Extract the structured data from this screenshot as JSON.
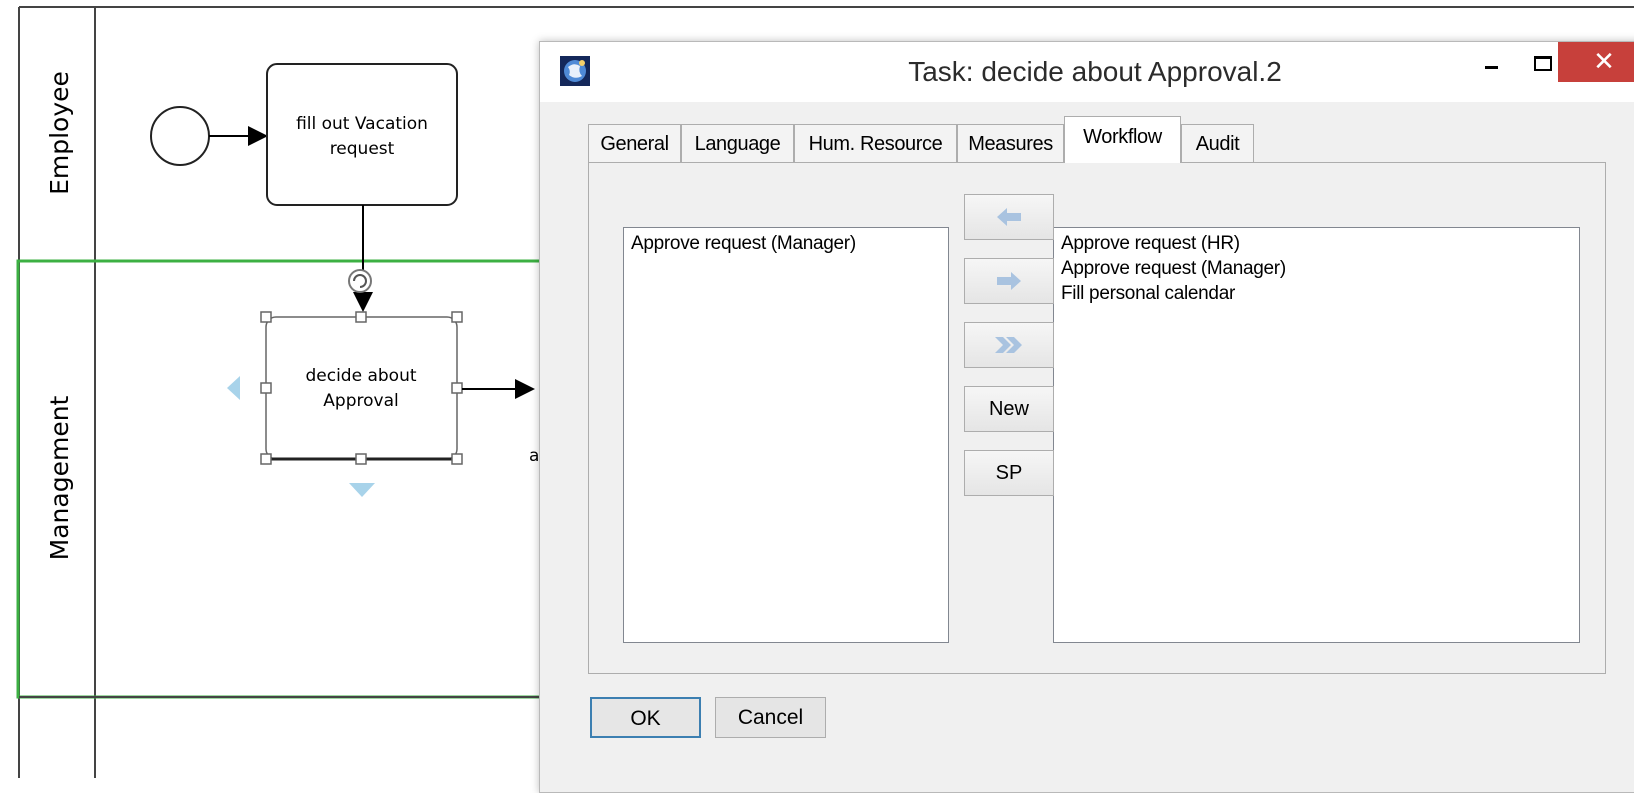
{
  "diagram": {
    "lanes": [
      {
        "label": "Employee"
      },
      {
        "label": "Management"
      }
    ],
    "tasks": {
      "fill_out": [
        "fill out Vacation",
        "request"
      ],
      "decide": [
        "decide about",
        "Approval"
      ]
    },
    "partial_label": "a"
  },
  "dialog": {
    "title": "Task: decide about Approval.2",
    "close_glyph": "✕",
    "tabs": [
      {
        "label": "General"
      },
      {
        "label": "Language"
      },
      {
        "label": "Hum. Resource"
      },
      {
        "label": "Measures"
      },
      {
        "label": "Workflow",
        "active": true
      },
      {
        "label": "Audit"
      }
    ],
    "left_list": {
      "items": [
        "Approve request (Manager)"
      ]
    },
    "right_list": {
      "items": [
        "Approve request (HR)",
        "Approve request (Manager)",
        "Fill personal calendar"
      ]
    },
    "buttons": {
      "move_left_icon": "arrow-left-icon",
      "move_right_icon": "arrow-right-icon",
      "move_all_icon": "double-arrow-right-icon",
      "new_label": "New",
      "sp_label": "SP",
      "ok_label": "OK",
      "cancel_label": "Cancel"
    },
    "colors": {
      "close_button": "#c7403b",
      "selection_lane": "#3cb043",
      "arrow_icons": "#a9c3e0",
      "ok_border": "#3c7fb1"
    }
  }
}
